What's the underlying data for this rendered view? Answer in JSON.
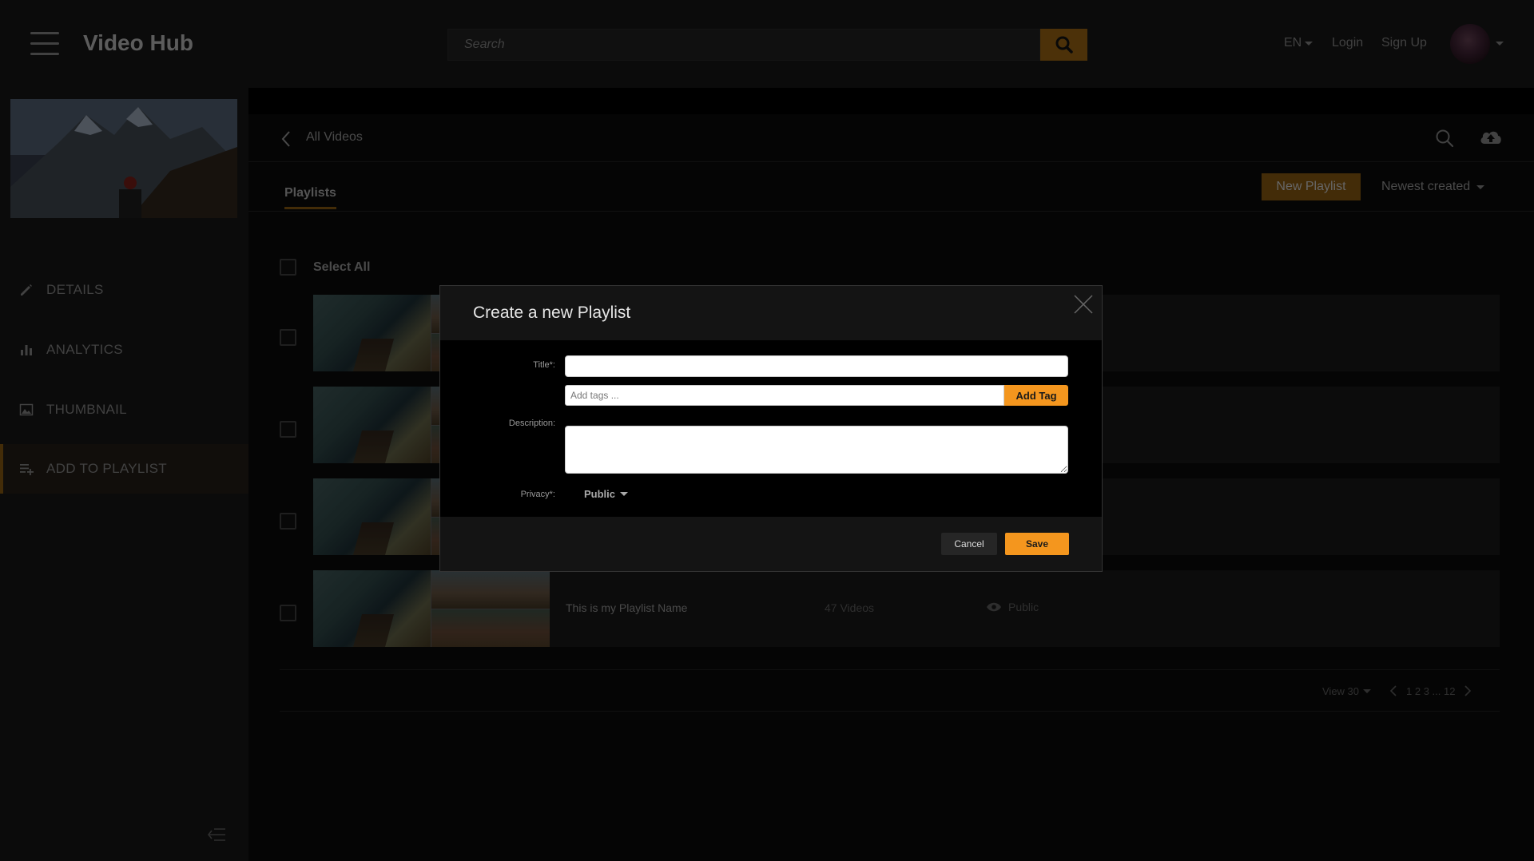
{
  "header": {
    "app_title": "Video Hub",
    "search_placeholder": "Search",
    "language": "EN",
    "login": "Login",
    "signup": "Sign Up"
  },
  "sidebar": {
    "items": [
      {
        "label": "DETAILS",
        "icon": "pencil-icon"
      },
      {
        "label": "ANALYTICS",
        "icon": "bar-chart-icon"
      },
      {
        "label": "THUMBNAIL",
        "icon": "image-icon"
      },
      {
        "label": "ADD TO PLAYLIST",
        "icon": "playlist-add-icon",
        "active": true
      }
    ]
  },
  "breadcrumb": {
    "label": "All Videos"
  },
  "tabs": {
    "playlists": "Playlists"
  },
  "toolbar": {
    "new_playlist": "New Playlist",
    "sort": "Newest created"
  },
  "list": {
    "select_all": "Select All",
    "last_row": {
      "name": "This is my Playlist Name",
      "count": "47 Videos",
      "privacy": "Public"
    }
  },
  "pagination": {
    "view": "View 30",
    "pages": "1 2 3 ... 12"
  },
  "modal": {
    "title": "Create a new Playlist",
    "title_label": "Title*:",
    "tags_placeholder": "Add tags ...",
    "add_tag": "Add Tag",
    "description_label": "Description:",
    "privacy_label": "Privacy*:",
    "privacy_value": "Public",
    "cancel": "Cancel",
    "save": "Save"
  },
  "colors": {
    "accent": "#f4961e",
    "accent_dim": "#7a5010",
    "background": "#0a0a0a",
    "panel": "#141414"
  }
}
